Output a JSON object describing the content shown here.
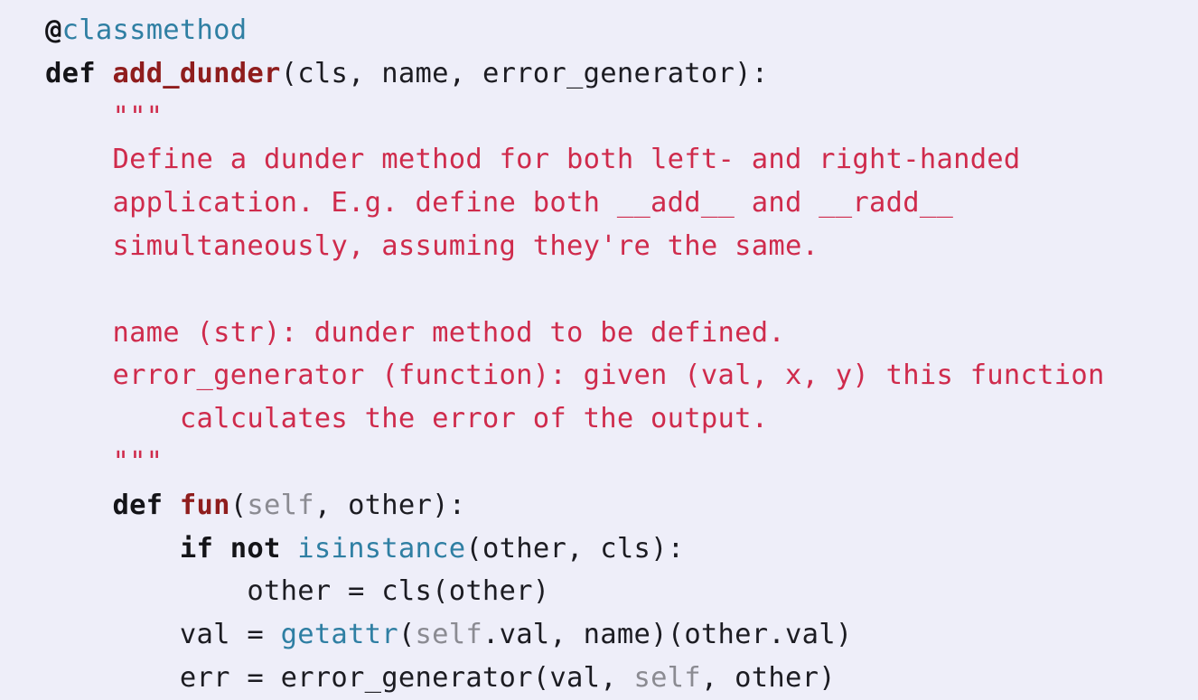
{
  "code": {
    "language": "python",
    "lines": [
      {
        "indent": "",
        "tokens": [
          {
            "t": "deco",
            "v": "@"
          },
          {
            "t": "deco-name",
            "v": "classmethod"
          }
        ]
      },
      {
        "indent": "",
        "tokens": [
          {
            "t": "kw",
            "v": "def"
          },
          {
            "t": "plain",
            "v": " "
          },
          {
            "t": "fn",
            "v": "add_dunder"
          },
          {
            "t": "plain",
            "v": "(cls, name, error_generator):"
          }
        ]
      },
      {
        "indent": "    ",
        "tokens": [
          {
            "t": "doc",
            "v": "\"\"\""
          }
        ]
      },
      {
        "indent": "    ",
        "tokens": [
          {
            "t": "doc",
            "v": "Define a dunder method for both left- and right-handed"
          }
        ]
      },
      {
        "indent": "    ",
        "tokens": [
          {
            "t": "doc",
            "v": "application. E.g. define both __add__ and __radd__"
          }
        ]
      },
      {
        "indent": "    ",
        "tokens": [
          {
            "t": "doc",
            "v": "simultaneously, assuming they're the same."
          }
        ]
      },
      {
        "indent": "",
        "tokens": []
      },
      {
        "indent": "    ",
        "tokens": [
          {
            "t": "doc",
            "v": "name (str): dunder method to be defined."
          }
        ]
      },
      {
        "indent": "    ",
        "tokens": [
          {
            "t": "doc",
            "v": "error_generator (function): given (val, x, y) this function"
          }
        ]
      },
      {
        "indent": "        ",
        "tokens": [
          {
            "t": "doc",
            "v": "calculates the error of the output."
          }
        ]
      },
      {
        "indent": "    ",
        "tokens": [
          {
            "t": "doc",
            "v": "\"\"\""
          }
        ]
      },
      {
        "indent": "    ",
        "tokens": [
          {
            "t": "kw",
            "v": "def"
          },
          {
            "t": "plain",
            "v": " "
          },
          {
            "t": "fn",
            "v": "fun"
          },
          {
            "t": "plain",
            "v": "("
          },
          {
            "t": "self",
            "v": "self"
          },
          {
            "t": "plain",
            "v": ", other):"
          }
        ]
      },
      {
        "indent": "        ",
        "tokens": [
          {
            "t": "kw",
            "v": "if"
          },
          {
            "t": "plain",
            "v": " "
          },
          {
            "t": "kw",
            "v": "not"
          },
          {
            "t": "plain",
            "v": " "
          },
          {
            "t": "builtin",
            "v": "isinstance"
          },
          {
            "t": "plain",
            "v": "(other, cls):"
          }
        ]
      },
      {
        "indent": "            ",
        "tokens": [
          {
            "t": "plain",
            "v": "other = cls(other)"
          }
        ]
      },
      {
        "indent": "        ",
        "tokens": [
          {
            "t": "plain",
            "v": "val = "
          },
          {
            "t": "builtin",
            "v": "getattr"
          },
          {
            "t": "plain",
            "v": "("
          },
          {
            "t": "self",
            "v": "self"
          },
          {
            "t": "plain",
            "v": ".val, name)(other.val)"
          }
        ]
      },
      {
        "indent": "        ",
        "tokens": [
          {
            "t": "plain",
            "v": "err = error_generator(val, "
          },
          {
            "t": "self",
            "v": "self"
          },
          {
            "t": "plain",
            "v": ", other)"
          }
        ]
      }
    ]
  },
  "colors": {
    "background": "#eeeef9",
    "keyword": "#141418",
    "function_name": "#8f1d1d",
    "builtin": "#2f7fa3",
    "self": "#8b8b92",
    "docstring": "#cf2b4c",
    "text": "#1c1c22"
  }
}
